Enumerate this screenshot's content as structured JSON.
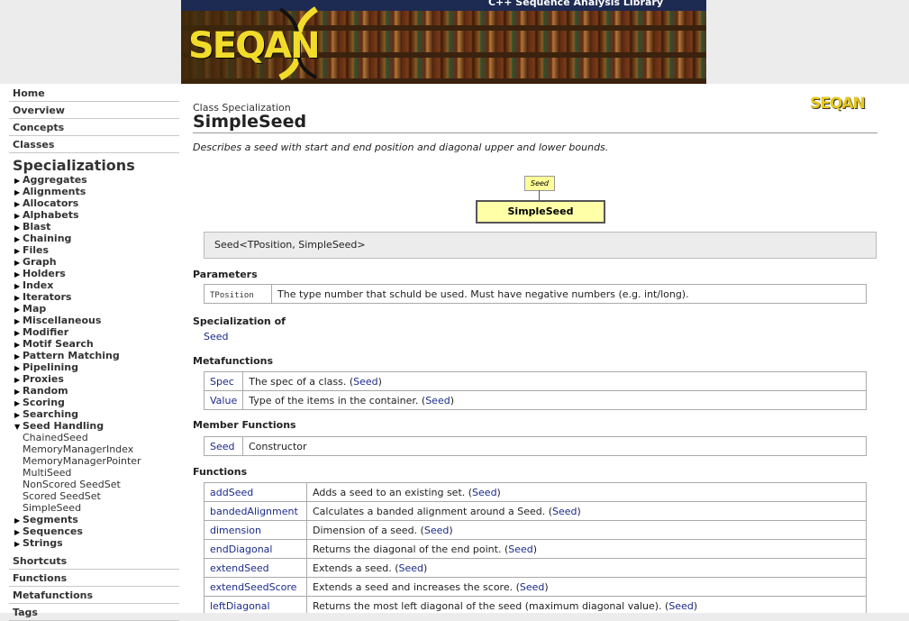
{
  "banner": {
    "tagline": "C++ Sequence Analysis Library",
    "logo_text": "SEQAN"
  },
  "sidebar": {
    "home": "Home",
    "overview": "Overview",
    "concepts": "Concepts",
    "classes": "Classes",
    "specializations_title": "Specializations",
    "categories_top": [
      "Aggregates",
      "Alignments",
      "Allocators",
      "Alphabets",
      "Blast",
      "Chaining",
      "Files",
      "Graph",
      "Holders",
      "Index",
      "Iterators",
      "Map",
      "Miscellaneous",
      "Modifier",
      "Motif Search",
      "Pattern Matching",
      "Pipelining",
      "Proxies",
      "Random",
      "Scoring",
      "Searching"
    ],
    "expanded": "Seed Handling",
    "expanded_items": [
      "ChainedSeed",
      "MemoryManagerIndex",
      "MemoryManagerPointer",
      "MultiSeed",
      "NonScored SeedSet",
      "Scored SeedSet",
      "SimpleSeed"
    ],
    "categories_bottom": [
      "Segments",
      "Sequences",
      "Strings"
    ],
    "shortcuts": "Shortcuts",
    "functions": "Functions",
    "metafunctions": "Metafunctions",
    "tags": "Tags"
  },
  "main": {
    "kind": "Class Specialization",
    "title": "SimpleSeed",
    "logo": "SEQAN",
    "description": "Describes a seed with start and end position and diagonal upper and lower bounds.",
    "diagram_parent": "Seed",
    "diagram_child": "SimpleSeed",
    "signature": "Seed<TPosition, SimpleSeed>",
    "parameters_title": "Parameters",
    "parameters": [
      {
        "name": "TPosition",
        "desc": "The type number that schuld be used. Must have negative numbers (e.g. int/long)."
      }
    ],
    "spec_of_title": "Specialization of",
    "spec_of": "Seed",
    "metafunctions_title": "Metafunctions",
    "metafunctions": [
      {
        "name": "Spec",
        "desc": "The spec of a class. (",
        "ref": "Seed",
        "end": ")"
      },
      {
        "name": "Value",
        "desc": "Type of the items in the container. (",
        "ref": "Seed",
        "end": ")"
      }
    ],
    "member_functions_title": "Member Functions",
    "member_functions": [
      {
        "name": "Seed",
        "desc": "Constructor"
      }
    ],
    "functions_title": "Functions",
    "functions": [
      {
        "name": "addSeed",
        "desc": "Adds a seed to an existing set. (",
        "ref": "Seed",
        "end": ")"
      },
      {
        "name": "bandedAlignment",
        "desc": "Calculates a banded alignment around a Seed. (",
        "ref": "Seed",
        "end": ")"
      },
      {
        "name": "dimension",
        "desc": "Dimension of a seed. (",
        "ref": "Seed",
        "end": ")"
      },
      {
        "name": "endDiagonal",
        "desc": "Returns the diagonal of the end point. (",
        "ref": "Seed",
        "end": ")"
      },
      {
        "name": "extendSeed",
        "desc": "Extends a seed. (",
        "ref": "Seed",
        "end": ")"
      },
      {
        "name": "extendSeedScore",
        "desc": "Extends a seed and increases the score. (",
        "ref": "Seed",
        "end": ")"
      },
      {
        "name": "leftDiagonal",
        "desc": "Returns the most left diagonal of the seed (maximum diagonal value). (",
        "ref": "Seed",
        "end": ")"
      }
    ]
  }
}
